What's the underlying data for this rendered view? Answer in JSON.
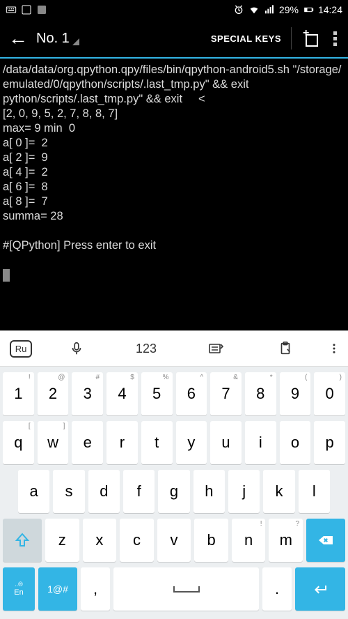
{
  "status": {
    "battery_pct": "29%",
    "time": "14:24"
  },
  "appbar": {
    "title": "No. 1",
    "special_keys": "SPECIAL KEYS"
  },
  "terminal": {
    "lines": [
      "/data/data/org.qpython.qpy/files/bin/qpython-android5.sh \"/storage/emulated/0/qpython/scripts/.last_tmp.py\" && exit",
      "python/scripts/.last_tmp.py\" && exit     <",
      "[2, 0, 9, 5, 2, 7, 8, 8, 7]",
      "max= 9 min  0",
      "a[ 0 ]=  2",
      "a[ 2 ]=  9",
      "a[ 4 ]=  2",
      "a[ 6 ]=  8",
      "a[ 8 ]=  7",
      "summa= 28",
      "",
      "#[QPython] Press enter to exit",
      ""
    ]
  },
  "keyboard": {
    "toolbar": {
      "lang": "Ru",
      "num": "123"
    },
    "row1": [
      {
        "k": "1",
        "a": "!"
      },
      {
        "k": "2",
        "a": "@"
      },
      {
        "k": "3",
        "a": "#"
      },
      {
        "k": "4",
        "a": "$"
      },
      {
        "k": "5",
        "a": "%"
      },
      {
        "k": "6",
        "a": "^"
      },
      {
        "k": "7",
        "a": "&"
      },
      {
        "k": "8",
        "a": "*"
      },
      {
        "k": "9",
        "a": "("
      },
      {
        "k": "0",
        "a": ")"
      }
    ],
    "row2": [
      {
        "k": "q",
        "a": "["
      },
      {
        "k": "w",
        "a": "]"
      },
      {
        "k": "e",
        "a": ""
      },
      {
        "k": "r",
        "a": ""
      },
      {
        "k": "t",
        "a": ""
      },
      {
        "k": "y",
        "a": ""
      },
      {
        "k": "u",
        "a": ""
      },
      {
        "k": "i",
        "a": ""
      },
      {
        "k": "o",
        "a": ""
      },
      {
        "k": "p",
        "a": ""
      }
    ],
    "row3": [
      {
        "k": "a"
      },
      {
        "k": "s"
      },
      {
        "k": "d"
      },
      {
        "k": "f"
      },
      {
        "k": "g"
      },
      {
        "k": "h"
      },
      {
        "k": "j"
      },
      {
        "k": "k"
      },
      {
        "k": "l"
      }
    ],
    "row4": [
      {
        "k": "z"
      },
      {
        "k": "x"
      },
      {
        "k": "c"
      },
      {
        "k": "v"
      },
      {
        "k": "b"
      },
      {
        "k": "n",
        "a": "!"
      },
      {
        "k": "m",
        "a": "?"
      }
    ],
    "bottom": {
      "lang_key_top": "..®",
      "lang_key": "En",
      "sym": "1@#",
      "comma": ",",
      "period": "."
    }
  }
}
